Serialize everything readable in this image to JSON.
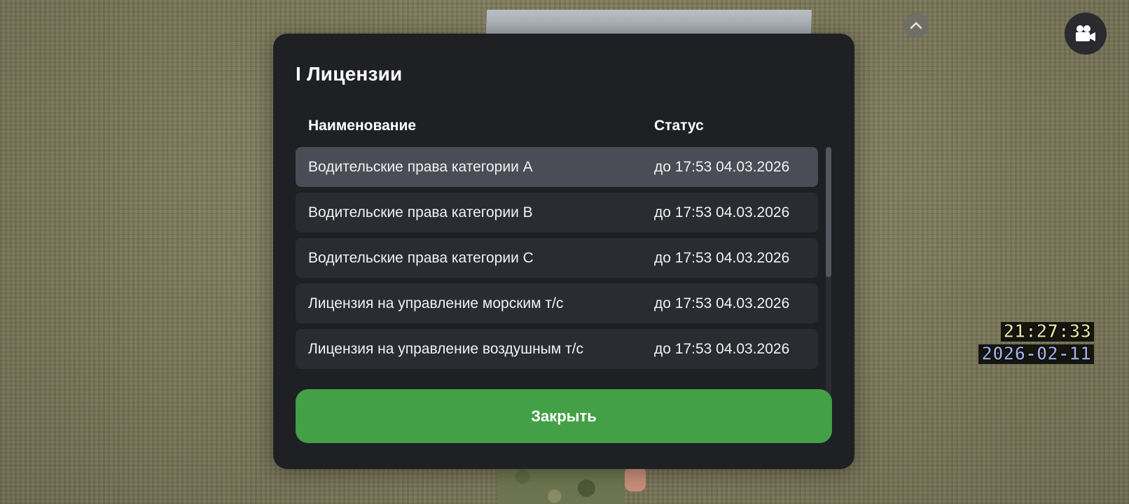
{
  "modal": {
    "title": "I Лицензии",
    "columns": {
      "name": "Наименование",
      "status": "Статус"
    },
    "rows": [
      {
        "name": "Водительские права категории A",
        "status": "до 17:53 04.03.2026",
        "selected": true
      },
      {
        "name": "Водительские права категории B",
        "status": "до 17:53 04.03.2026",
        "selected": false
      },
      {
        "name": "Водительские права категории C",
        "status": "до 17:53 04.03.2026",
        "selected": false
      },
      {
        "name": "Лицензия на управление морским т/с",
        "status": "до 17:53 04.03.2026",
        "selected": false
      },
      {
        "name": "Лицензия на управление воздушным т/с",
        "status": "до 17:53 04.03.2026",
        "selected": false
      }
    ],
    "close_label": "Закрыть"
  },
  "hud": {
    "time": "21:27:33",
    "date": "2026-02-11",
    "icons": {
      "collapse": "chevron-up-icon",
      "camera": "video-camera-icon"
    }
  },
  "colors": {
    "panel_bg": "#1f2024",
    "row_bg": "#2b2c31",
    "row_selected_bg": "#4b4c56",
    "accent_green": "#43a047",
    "time_text": "#e8e3a0",
    "date_text": "#a3b0e6"
  }
}
